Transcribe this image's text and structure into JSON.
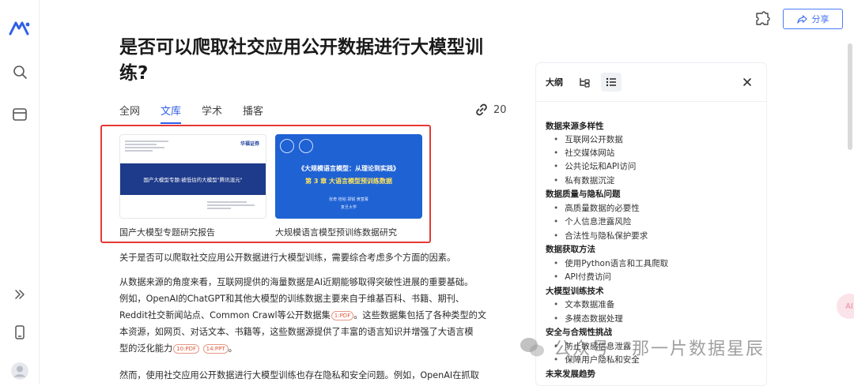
{
  "header": {
    "share_label": "分享"
  },
  "article": {
    "title_line1": "是否可以爬取社交应用公开数据进行大模型训",
    "title_line2": "练?",
    "tabs": [
      {
        "label": "全网"
      },
      {
        "label": "文库",
        "active": true
      },
      {
        "label": "学术"
      },
      {
        "label": "播客"
      }
    ],
    "link_count": "20",
    "cards": [
      {
        "caption": "国产大模型专题研究报告",
        "thumb_header": "华福证券",
        "thumb_title": "国产大模型专题:被低估的大模型\"腾讯混元\""
      },
      {
        "caption": "大规模语言模型预训练数据研究",
        "thumb_title_1": "《大规模语言模型：从理论到实践》",
        "thumb_title_2": "第 3 章 大语言模型预训练数据",
        "thumb_authors": "张奇 桂韬 郑锐 黄萱菁",
        "thumb_org": "复旦大学"
      }
    ],
    "p1": "关于是否可以爬取社交应用公开数据进行大模型训练，需要综合考虑多个方面的因素。",
    "p2_l1": "从数据来源的角度来看，互联网提供的海量数据是AI近期能够取得突破性进展的重要基础。",
    "p2_l2": "例如，OpenAI的ChatGPT和其他大模型的训练数据主要来自于维基百科、书籍、期刊、",
    "p2_l3": "Reddit社交新闻站点、Common Crawl等公开数据集",
    "p2_pill1": "1:PDF",
    "p2_l3b": "。这些数据集包括了各种类型的文",
    "p2_l4": "本资源，如网页、对话文本、书籍等，这些数据源提供了丰富的语言知识并增强了大语言模",
    "p2_l5": "型的泛化能力",
    "p2_pill2": "10:PDF",
    "p2_pill3": "14:PPT",
    "p2_l5b": "。",
    "p3": "然而，使用社交应用公开数据进行大模型训练也存在隐私和安全问题。例如，OpenAI在抓取"
  },
  "outline": {
    "title": "大纲",
    "sections": [
      {
        "title": "数据来源多样性",
        "items": [
          "互联网公开数据",
          "社交媒体网站",
          "公共论坛和API访问",
          "私有数据沉淀"
        ]
      },
      {
        "title": "数据质量与隐私问题",
        "items": [
          "高质量数据的必要性",
          "个人信息泄露风险",
          "合法性与隐私保护要求"
        ]
      },
      {
        "title": "数据获取方法",
        "items": [
          "使用Python语言和工具爬取",
          "API付费访问"
        ]
      },
      {
        "title": "大模型训练技术",
        "items": [
          "文本数据准备",
          "多模态数据处理"
        ]
      },
      {
        "title": "安全与合规性挑战",
        "items": [
          "防止敏感信息泄露",
          "保障用户隐私和安全"
        ]
      },
      {
        "title": "未来发展趋势",
        "items": []
      }
    ]
  },
  "watermark": {
    "text": "公众号 · 那一片数据星辰"
  },
  "float_ball": {
    "label": "AI"
  }
}
